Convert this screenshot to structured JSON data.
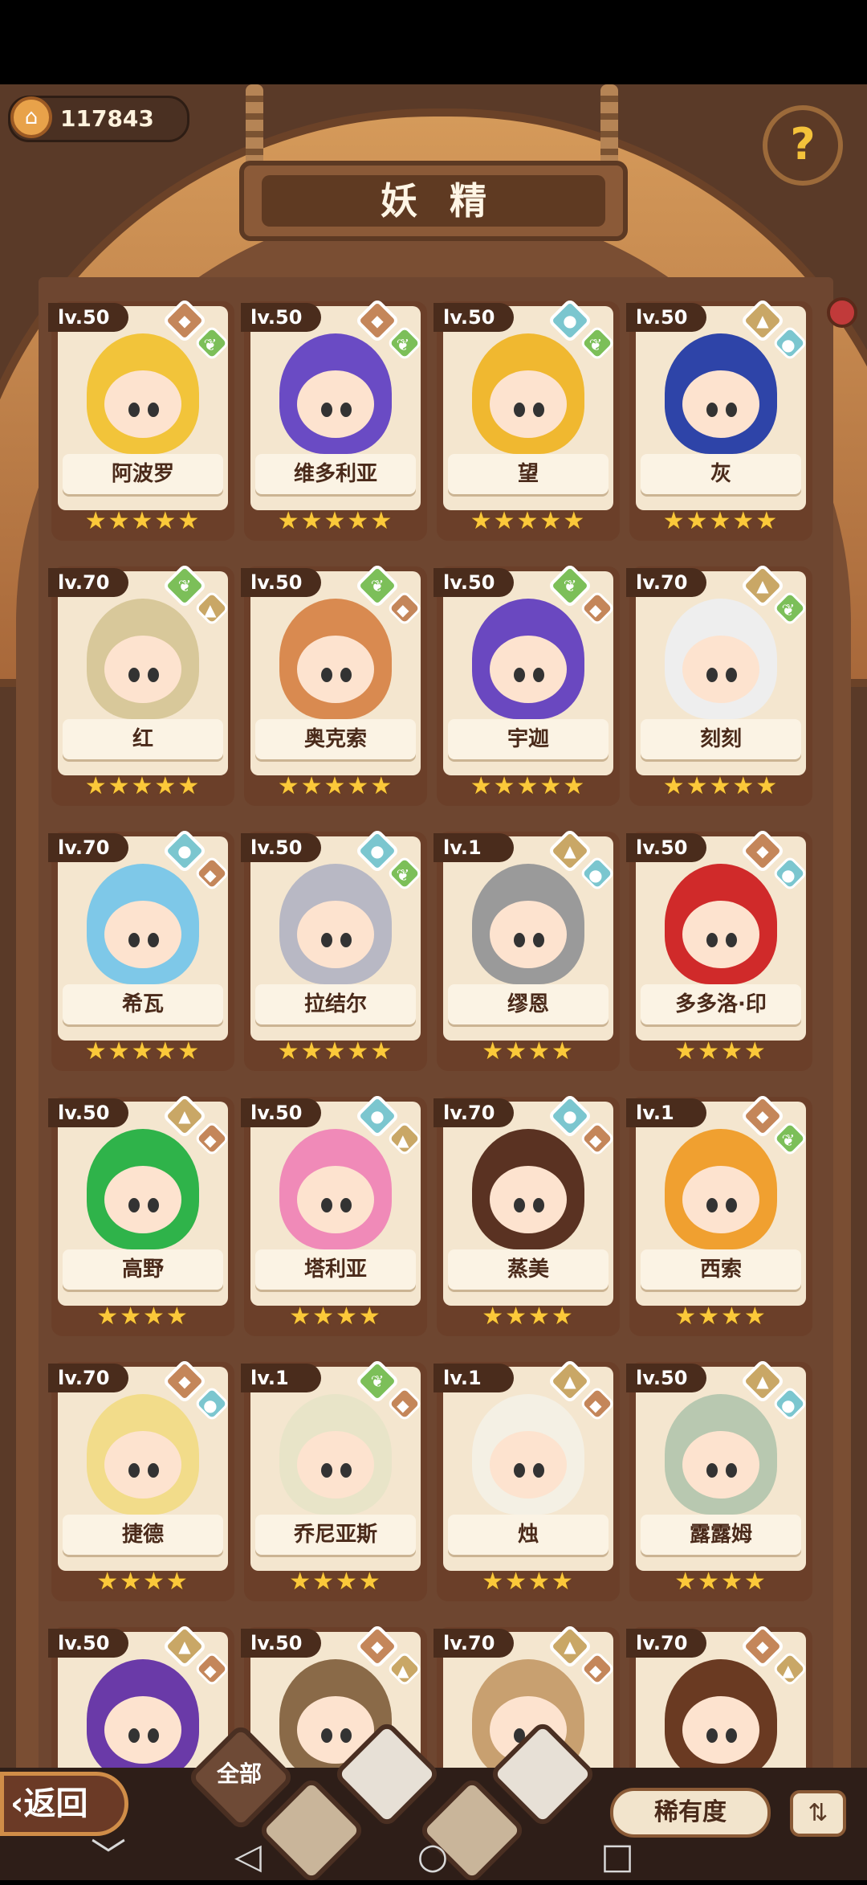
{
  "header": {
    "coins": "117843",
    "title": "妖精",
    "help_icon": "question-sprout-icon"
  },
  "colors": {
    "fire": "#c4865a",
    "earth": "#c9a766",
    "water": "#7bc6cf",
    "wood": "#7cbf59",
    "star": "#fbc93a"
  },
  "fairies": [
    {
      "level": "lv.50",
      "name": "阿波罗",
      "stars": "★★★★★",
      "el": [
        "fire",
        "wood"
      ],
      "hair": "#f2c43a"
    },
    {
      "level": "lv.50",
      "name": "维多利亚",
      "stars": "★★★★★",
      "el": [
        "fire",
        "wood"
      ],
      "hair": "#6a4bc4"
    },
    {
      "level": "lv.50",
      "name": "望",
      "stars": "★★★★★",
      "el": [
        "water",
        "wood"
      ],
      "hair": "#f0b830"
    },
    {
      "level": "lv.50",
      "name": "灰",
      "stars": "★★★★★",
      "el": [
        "earth",
        "water"
      ],
      "hair": "#2e44a8"
    },
    {
      "level": "lv.70",
      "name": "红",
      "stars": "★★★★★",
      "el": [
        "wood",
        "earth"
      ],
      "hair": "#d8c89a"
    },
    {
      "level": "lv.50",
      "name": "奥克索",
      "stars": "★★★★★",
      "el": [
        "wood",
        "fire"
      ],
      "hair": "#d98a50"
    },
    {
      "level": "lv.50",
      "name": "宇迦",
      "stars": "★★★★★",
      "el": [
        "wood",
        "fire"
      ],
      "hair": "#6a48c0"
    },
    {
      "level": "lv.70",
      "name": "刻刻",
      "stars": "★★★★★",
      "el": [
        "earth",
        "wood"
      ],
      "hair": "#eeeeee"
    },
    {
      "level": "lv.70",
      "name": "希瓦",
      "stars": "★★★★★",
      "el": [
        "water",
        "fire"
      ],
      "hair": "#7ec8e8"
    },
    {
      "level": "lv.50",
      "name": "拉结尔",
      "stars": "★★★★★",
      "el": [
        "water",
        "wood"
      ],
      "hair": "#b8b8c4"
    },
    {
      "level": "lv.1",
      "name": "缪恩",
      "stars": "★★★★",
      "el": [
        "earth",
        "water"
      ],
      "hair": "#9a9a9a"
    },
    {
      "level": "lv.50",
      "name": "多多洛·印",
      "stars": "★★★★",
      "el": [
        "fire",
        "water"
      ],
      "hair": "#d02a2a"
    },
    {
      "level": "lv.50",
      "name": "高野",
      "stars": "★★★★",
      "el": [
        "earth",
        "fire"
      ],
      "hair": "#2fb34a"
    },
    {
      "level": "lv.50",
      "name": "塔利亚",
      "stars": "★★★★",
      "el": [
        "water",
        "earth"
      ],
      "hair": "#f08ab8"
    },
    {
      "level": "lv.70",
      "name": "蒸美",
      "stars": "★★★★",
      "el": [
        "water",
        "fire"
      ],
      "hair": "#5a3222"
    },
    {
      "level": "lv.1",
      "name": "西索",
      "stars": "★★★★",
      "el": [
        "fire",
        "wood"
      ],
      "hair": "#f0a030"
    },
    {
      "level": "lv.70",
      "name": "捷德",
      "stars": "★★★★",
      "el": [
        "fire",
        "water"
      ],
      "hair": "#f2dc8a"
    },
    {
      "level": "lv.1",
      "name": "乔尼亚斯",
      "stars": "★★★★",
      "el": [
        "wood",
        "fire"
      ],
      "hair": "#e8e4c8"
    },
    {
      "level": "lv.1",
      "name": "烛",
      "stars": "★★★★",
      "el": [
        "earth",
        "fire"
      ],
      "hair": "#f4f0e4"
    },
    {
      "level": "lv.50",
      "name": "露露姆",
      "stars": "★★★★",
      "el": [
        "earth",
        "water"
      ],
      "hair": "#b8c8b0"
    },
    {
      "level": "lv.50",
      "name": "",
      "stars": "",
      "el": [
        "earth",
        "fire"
      ],
      "hair": "#6a3aa8"
    },
    {
      "level": "lv.50",
      "name": "",
      "stars": "",
      "el": [
        "fire",
        "earth"
      ],
      "hair": "#8a6a48"
    },
    {
      "level": "lv.70",
      "name": "",
      "stars": "",
      "el": [
        "earth",
        "fire"
      ],
      "hair": "#c8a070"
    },
    {
      "level": "lv.70",
      "name": "",
      "stars": "",
      "el": [
        "fire",
        "earth"
      ],
      "hair": "#6a3a22"
    }
  ],
  "bottom": {
    "back_label": "‹返回",
    "filter_all": "全部",
    "sort_label": "稀有度",
    "order_icon": "sort-order-icon"
  },
  "nav": {
    "down": "﹀",
    "back": "◁",
    "home": "○",
    "recents": "□"
  }
}
